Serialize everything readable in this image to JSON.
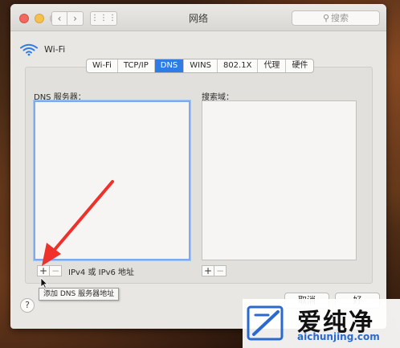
{
  "window": {
    "title": "网络",
    "search_placeholder": "搜索",
    "nav_back_glyph": "‹",
    "nav_forward_glyph": "›",
    "grid_glyph": "⋮⋮⋮"
  },
  "interface": {
    "name": "Wi-Fi",
    "icon": "wifi-icon"
  },
  "tabs": [
    {
      "label": "Wi-Fi",
      "active": false
    },
    {
      "label": "TCP/IP",
      "active": false
    },
    {
      "label": "DNS",
      "active": true
    },
    {
      "label": "WINS",
      "active": false
    },
    {
      "label": "802.1X",
      "active": false
    },
    {
      "label": "代理",
      "active": false
    },
    {
      "label": "硬件",
      "active": false
    }
  ],
  "dns": {
    "servers_label": "DNS 服务器：",
    "search_domains_label": "搜索域：",
    "address_hint": "IPv4 或 IPv6 地址",
    "add_glyph": "+",
    "remove_glyph": "−",
    "tooltip": "添加 DNS 服务器地址"
  },
  "footer": {
    "help_glyph": "?",
    "cancel_label": "取消",
    "ok_label": "好"
  },
  "watermark": {
    "brand": "爱纯净",
    "url": "aichunjing.com"
  },
  "colors": {
    "accent": "#2f7ce6",
    "annotation_arrow": "#f0302a"
  }
}
